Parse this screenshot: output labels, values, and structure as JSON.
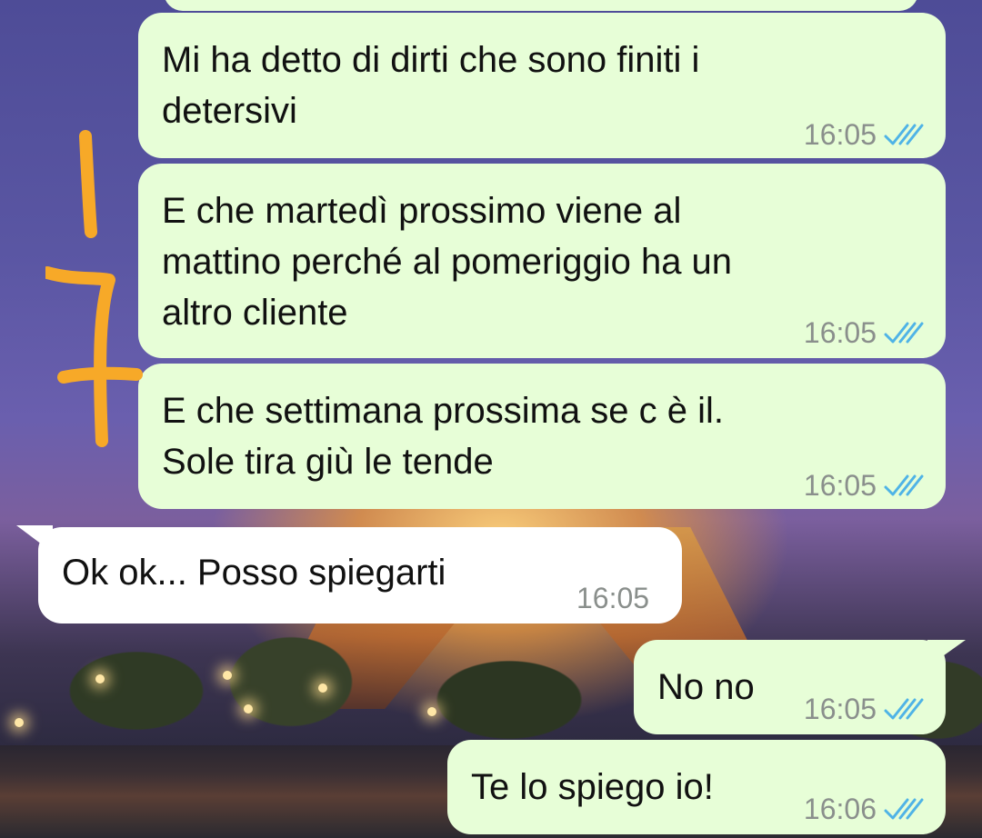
{
  "messages": [
    {
      "direction": "outgoing",
      "text": "",
      "time": ""
    },
    {
      "direction": "outgoing",
      "lines": [
        "Mi ha detto di dirti che sono finiti i",
        "detersivi"
      ],
      "time": "16:05",
      "status": "read"
    },
    {
      "direction": "outgoing",
      "lines": [
        "E che martedì prossimo viene al",
        "mattino perché al pomeriggio ha un",
        "altro cliente"
      ],
      "time": "16:05",
      "status": "read"
    },
    {
      "direction": "outgoing",
      "lines": [
        "E che settimana prossima se c è il.",
        "Sole tira giù le tende"
      ],
      "time": "16:05",
      "status": "read"
    },
    {
      "direction": "incoming",
      "lines": [
        "Ok ok... Posso spiegarti"
      ],
      "time": "16:05"
    },
    {
      "direction": "outgoing",
      "lines": [
        "No no"
      ],
      "time": "16:05",
      "status": "read"
    },
    {
      "direction": "outgoing",
      "lines": [
        "Te lo spiego io!"
      ],
      "time": "16:06",
      "status": "read"
    }
  ],
  "colors": {
    "outgoing_bubble": "#e7fed7",
    "incoming_bubble": "#ffffff",
    "read_tick": "#4fb3e6",
    "annotation": "#f7a928",
    "timestamp": "#8a8f8c"
  },
  "icons": {
    "read_receipt": "double-check-icon"
  }
}
